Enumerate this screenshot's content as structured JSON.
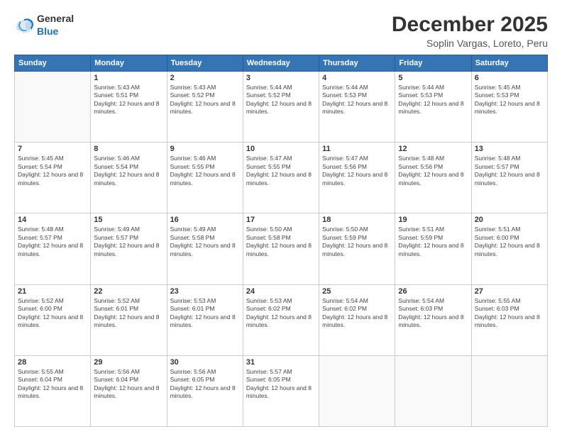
{
  "header": {
    "logo_general": "General",
    "logo_blue": "Blue",
    "main_title": "December 2025",
    "subtitle": "Soplin Vargas, Loreto, Peru"
  },
  "days": [
    "Sunday",
    "Monday",
    "Tuesday",
    "Wednesday",
    "Thursday",
    "Friday",
    "Saturday"
  ],
  "weeks": [
    [
      {
        "date": "",
        "sunrise": "",
        "sunset": "",
        "daylight": ""
      },
      {
        "date": "1",
        "sunrise": "Sunrise: 5:43 AM",
        "sunset": "Sunset: 5:51 PM",
        "daylight": "Daylight: 12 hours and 8 minutes."
      },
      {
        "date": "2",
        "sunrise": "Sunrise: 5:43 AM",
        "sunset": "Sunset: 5:52 PM",
        "daylight": "Daylight: 12 hours and 8 minutes."
      },
      {
        "date": "3",
        "sunrise": "Sunrise: 5:44 AM",
        "sunset": "Sunset: 5:52 PM",
        "daylight": "Daylight: 12 hours and 8 minutes."
      },
      {
        "date": "4",
        "sunrise": "Sunrise: 5:44 AM",
        "sunset": "Sunset: 5:53 PM",
        "daylight": "Daylight: 12 hours and 8 minutes."
      },
      {
        "date": "5",
        "sunrise": "Sunrise: 5:44 AM",
        "sunset": "Sunset: 5:53 PM",
        "daylight": "Daylight: 12 hours and 8 minutes."
      },
      {
        "date": "6",
        "sunrise": "Sunrise: 5:45 AM",
        "sunset": "Sunset: 5:53 PM",
        "daylight": "Daylight: 12 hours and 8 minutes."
      }
    ],
    [
      {
        "date": "7",
        "sunrise": "Sunrise: 5:45 AM",
        "sunset": "Sunset: 5:54 PM",
        "daylight": "Daylight: 12 hours and 8 minutes."
      },
      {
        "date": "8",
        "sunrise": "Sunrise: 5:46 AM",
        "sunset": "Sunset: 5:54 PM",
        "daylight": "Daylight: 12 hours and 8 minutes."
      },
      {
        "date": "9",
        "sunrise": "Sunrise: 5:46 AM",
        "sunset": "Sunset: 5:55 PM",
        "daylight": "Daylight: 12 hours and 8 minutes."
      },
      {
        "date": "10",
        "sunrise": "Sunrise: 5:47 AM",
        "sunset": "Sunset: 5:55 PM",
        "daylight": "Daylight: 12 hours and 8 minutes."
      },
      {
        "date": "11",
        "sunrise": "Sunrise: 5:47 AM",
        "sunset": "Sunset: 5:56 PM",
        "daylight": "Daylight: 12 hours and 8 minutes."
      },
      {
        "date": "12",
        "sunrise": "Sunrise: 5:48 AM",
        "sunset": "Sunset: 5:56 PM",
        "daylight": "Daylight: 12 hours and 8 minutes."
      },
      {
        "date": "13",
        "sunrise": "Sunrise: 5:48 AM",
        "sunset": "Sunset: 5:57 PM",
        "daylight": "Daylight: 12 hours and 8 minutes."
      }
    ],
    [
      {
        "date": "14",
        "sunrise": "Sunrise: 5:48 AM",
        "sunset": "Sunset: 5:57 PM",
        "daylight": "Daylight: 12 hours and 8 minutes."
      },
      {
        "date": "15",
        "sunrise": "Sunrise: 5:49 AM",
        "sunset": "Sunset: 5:57 PM",
        "daylight": "Daylight: 12 hours and 8 minutes."
      },
      {
        "date": "16",
        "sunrise": "Sunrise: 5:49 AM",
        "sunset": "Sunset: 5:58 PM",
        "daylight": "Daylight: 12 hours and 8 minutes."
      },
      {
        "date": "17",
        "sunrise": "Sunrise: 5:50 AM",
        "sunset": "Sunset: 5:58 PM",
        "daylight": "Daylight: 12 hours and 8 minutes."
      },
      {
        "date": "18",
        "sunrise": "Sunrise: 5:50 AM",
        "sunset": "Sunset: 5:59 PM",
        "daylight": "Daylight: 12 hours and 8 minutes."
      },
      {
        "date": "19",
        "sunrise": "Sunrise: 5:51 AM",
        "sunset": "Sunset: 5:59 PM",
        "daylight": "Daylight: 12 hours and 8 minutes."
      },
      {
        "date": "20",
        "sunrise": "Sunrise: 5:51 AM",
        "sunset": "Sunset: 6:00 PM",
        "daylight": "Daylight: 12 hours and 8 minutes."
      }
    ],
    [
      {
        "date": "21",
        "sunrise": "Sunrise: 5:52 AM",
        "sunset": "Sunset: 6:00 PM",
        "daylight": "Daylight: 12 hours and 8 minutes."
      },
      {
        "date": "22",
        "sunrise": "Sunrise: 5:52 AM",
        "sunset": "Sunset: 6:01 PM",
        "daylight": "Daylight: 12 hours and 8 minutes."
      },
      {
        "date": "23",
        "sunrise": "Sunrise: 5:53 AM",
        "sunset": "Sunset: 6:01 PM",
        "daylight": "Daylight: 12 hours and 8 minutes."
      },
      {
        "date": "24",
        "sunrise": "Sunrise: 5:53 AM",
        "sunset": "Sunset: 6:02 PM",
        "daylight": "Daylight: 12 hours and 8 minutes."
      },
      {
        "date": "25",
        "sunrise": "Sunrise: 5:54 AM",
        "sunset": "Sunset: 6:02 PM",
        "daylight": "Daylight: 12 hours and 8 minutes."
      },
      {
        "date": "26",
        "sunrise": "Sunrise: 5:54 AM",
        "sunset": "Sunset: 6:03 PM",
        "daylight": "Daylight: 12 hours and 8 minutes."
      },
      {
        "date": "27",
        "sunrise": "Sunrise: 5:55 AM",
        "sunset": "Sunset: 6:03 PM",
        "daylight": "Daylight: 12 hours and 8 minutes."
      }
    ],
    [
      {
        "date": "28",
        "sunrise": "Sunrise: 5:55 AM",
        "sunset": "Sunset: 6:04 PM",
        "daylight": "Daylight: 12 hours and 8 minutes."
      },
      {
        "date": "29",
        "sunrise": "Sunrise: 5:56 AM",
        "sunset": "Sunset: 6:04 PM",
        "daylight": "Daylight: 12 hours and 8 minutes."
      },
      {
        "date": "30",
        "sunrise": "Sunrise: 5:56 AM",
        "sunset": "Sunset: 6:05 PM",
        "daylight": "Daylight: 12 hours and 8 minutes."
      },
      {
        "date": "31",
        "sunrise": "Sunrise: 5:57 AM",
        "sunset": "Sunset: 6:05 PM",
        "daylight": "Daylight: 12 hours and 8 minutes."
      },
      {
        "date": "",
        "sunrise": "",
        "sunset": "",
        "daylight": ""
      },
      {
        "date": "",
        "sunrise": "",
        "sunset": "",
        "daylight": ""
      },
      {
        "date": "",
        "sunrise": "",
        "sunset": "",
        "daylight": ""
      }
    ]
  ]
}
